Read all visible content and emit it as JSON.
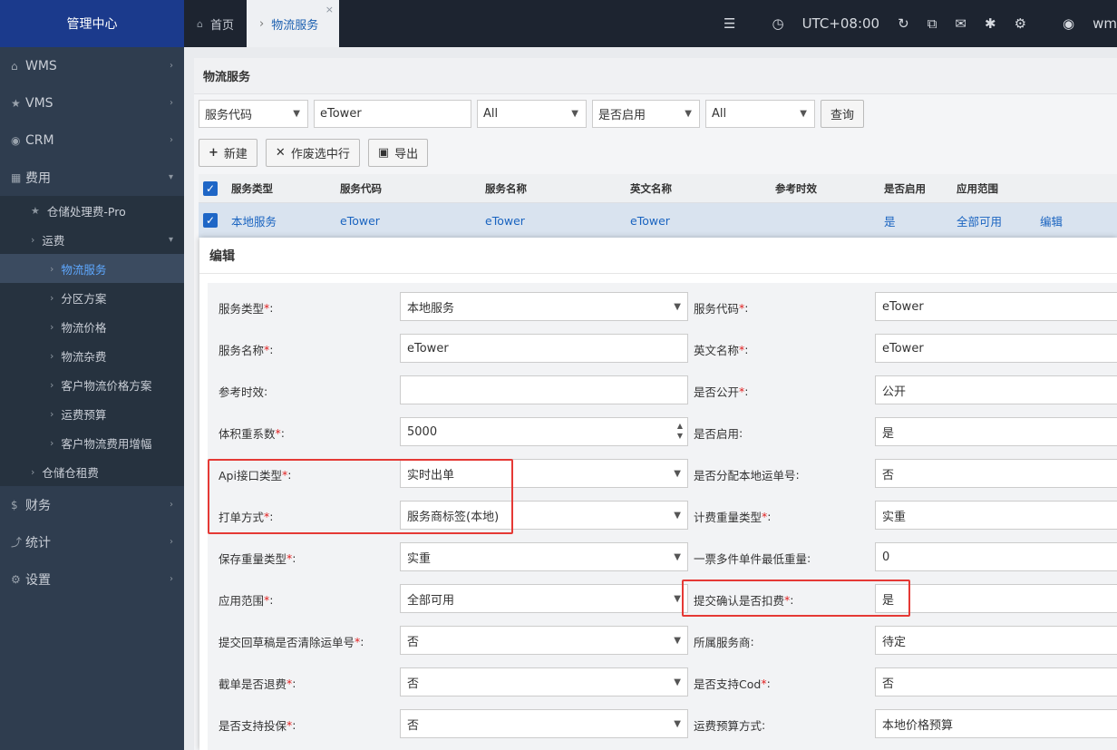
{
  "sidebar": {
    "title": "管理中心",
    "items": [
      {
        "icon": "bank-icon",
        "label": "WMS"
      },
      {
        "icon": "star-icon",
        "label": "VMS"
      },
      {
        "icon": "user-circle-icon",
        "label": "CRM"
      },
      {
        "icon": "table-icon",
        "label": "费用"
      }
    ],
    "sub": [
      {
        "label": "仓储处理费-Pro",
        "level": 1,
        "icon": "star"
      },
      {
        "label": "运费",
        "level": 1
      },
      {
        "label": "物流服务",
        "level": 2,
        "active": true
      },
      {
        "label": "分区方案",
        "level": 2
      },
      {
        "label": "物流价格",
        "level": 2
      },
      {
        "label": "物流杂费",
        "level": 2
      },
      {
        "label": "客户物流价格方案",
        "level": 2
      },
      {
        "label": "运费预算",
        "level": 2
      },
      {
        "label": "客户物流费用增幅",
        "level": 2
      },
      {
        "label": "仓储仓租费",
        "level": 1
      }
    ],
    "bottom": [
      {
        "icon": "dollar-icon",
        "label": "财务"
      },
      {
        "icon": "chart-icon",
        "label": "统计"
      },
      {
        "icon": "gear-icon",
        "label": "设置"
      }
    ]
  },
  "topbar": {
    "home_tab": "首页",
    "active_tab": "物流服务",
    "timezone": "UTC+08:00",
    "user": "wm"
  },
  "page": {
    "title": "物流服务",
    "filter1": "服务代码",
    "filter1_value": "eTower",
    "filter2": "All",
    "filter3": "是否启用",
    "filter4": "All",
    "query": "查询",
    "new": "新建",
    "void": "作废选中行",
    "export": "导出"
  },
  "grid": {
    "headers": [
      "服务类型",
      "服务代码",
      "服务名称",
      "英文名称",
      "参考时效",
      "是否启用",
      "应用范围"
    ],
    "row": [
      "本地服务",
      "eTower",
      "eTower",
      "eTower",
      "",
      "是",
      "全部可用"
    ],
    "edit": "编辑"
  },
  "modal": {
    "title": "编辑",
    "rows": [
      {
        "l1": "服务类型",
        "r1": true,
        "v1": "本地服务",
        "t1": "select",
        "l2": "服务代码",
        "r2": true,
        "v2": "eTower"
      },
      {
        "l1": "服务名称",
        "r1": true,
        "v1": "eTower",
        "t1": "text",
        "l2": "英文名称",
        "r2": true,
        "v2": "eTower"
      },
      {
        "l1": "参考时效",
        "r1": false,
        "v1": "",
        "t1": "text",
        "l2": "是否公开",
        "r2": true,
        "v2": "公开"
      },
      {
        "l1": "体积重系数",
        "r1": true,
        "v1": "5000",
        "t1": "number",
        "l2": "是否启用",
        "r2": false,
        "v2": "是"
      },
      {
        "l1": "Api接口类型",
        "r1": true,
        "v1": "实时出单",
        "t1": "select",
        "l2": "是否分配本地运单号",
        "r2": false,
        "v2": "否"
      },
      {
        "l1": "打单方式",
        "r1": true,
        "v1": "服务商标签(本地)",
        "t1": "select",
        "l2": "计费重量类型",
        "r2": true,
        "v2": "实重"
      },
      {
        "l1": "保存重量类型",
        "r1": true,
        "v1": "实重",
        "t1": "select",
        "l2": "一票多件单件最低重量",
        "r2": false,
        "v2": "0"
      },
      {
        "l1": "应用范围",
        "r1": true,
        "v1": "全部可用",
        "t1": "select",
        "l2": "提交确认是否扣费",
        "r2": true,
        "v2": "是"
      },
      {
        "l1": "提交回草稿是否清除运单号",
        "r1": true,
        "v1": "否",
        "t1": "select",
        "l2": "所属服务商",
        "r2": false,
        "v2": "待定"
      },
      {
        "l1": "截单是否退费",
        "r1": true,
        "v1": "否",
        "t1": "select",
        "l2": "是否支持Cod",
        "r2": true,
        "v2": "否"
      },
      {
        "l1": "是否支持投保",
        "r1": true,
        "v1": "否",
        "t1": "select",
        "l2": "运费预算方式",
        "r2": false,
        "v2": "本地价格预算"
      }
    ]
  },
  "colors": {
    "accent": "#1e66c6",
    "highlight": "#e53935"
  }
}
